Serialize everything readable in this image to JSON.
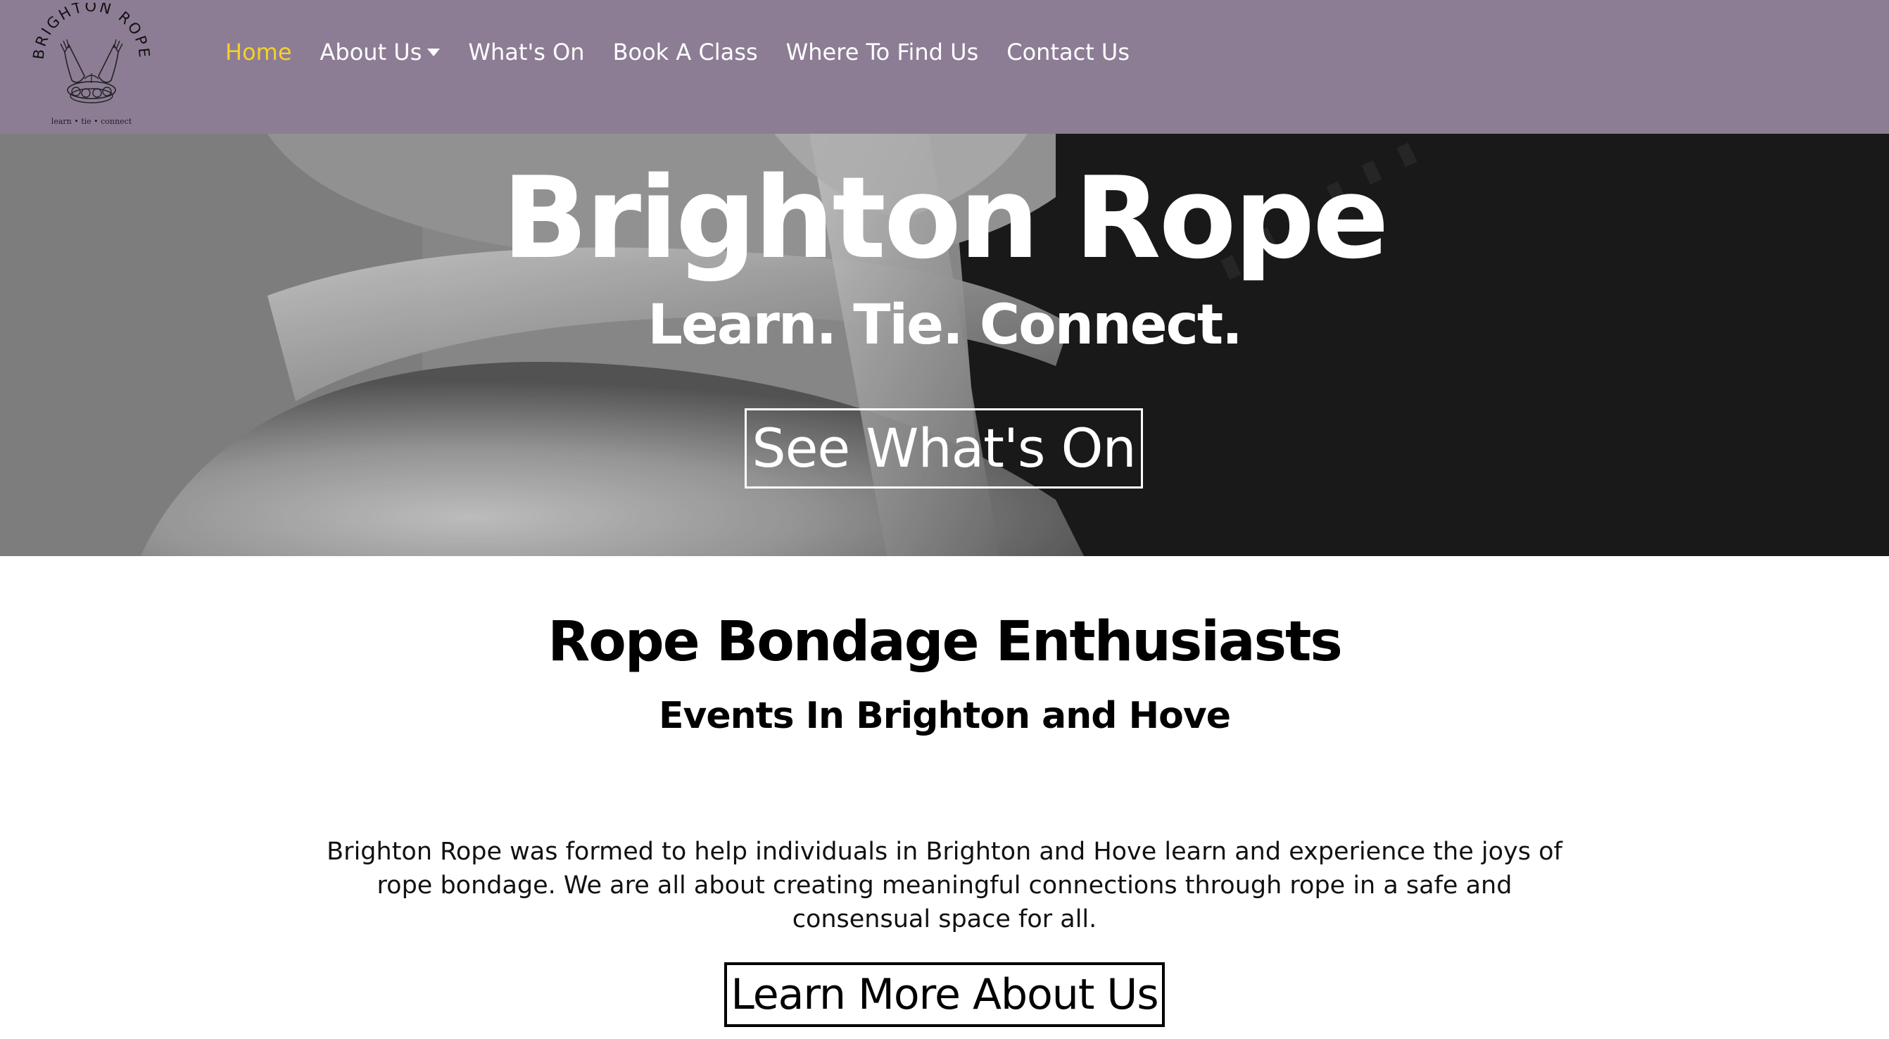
{
  "brand": {
    "logo_arc_text": "BRIGHTON ROPE",
    "logo_motto": "learn • tie • connect"
  },
  "nav": {
    "items": [
      {
        "label": "Home",
        "active": true
      },
      {
        "label": "About Us",
        "has_dropdown": true
      },
      {
        "label": "What's On"
      },
      {
        "label": "Book A Class"
      },
      {
        "label": "Where To Find Us"
      },
      {
        "label": "Contact Us"
      }
    ]
  },
  "hero": {
    "title": "Brighton Rope",
    "tagline": "Learn. Tie. Connect.",
    "cta_label": "See What's On"
  },
  "intro_section": {
    "heading": "Rope Bondage Enthusiasts",
    "subheading": "Events In Brighton and Hove",
    "body": "Brighton Rope was formed to help individuals in Brighton and Hove learn and experience the joys of rope bondage. We are all about creating meaningful connections through rope in a safe and consensual space for all.",
    "cta_label": "Learn More About Us"
  },
  "colors": {
    "nav_background": "#8c7d95",
    "nav_active": "#f5d02b",
    "nav_text": "#ffffff",
    "page_background": "#ffffff",
    "text": "#000000"
  },
  "icons": {
    "logo": "hands-holding-rope-logo",
    "dropdown": "caret-down-icon"
  }
}
